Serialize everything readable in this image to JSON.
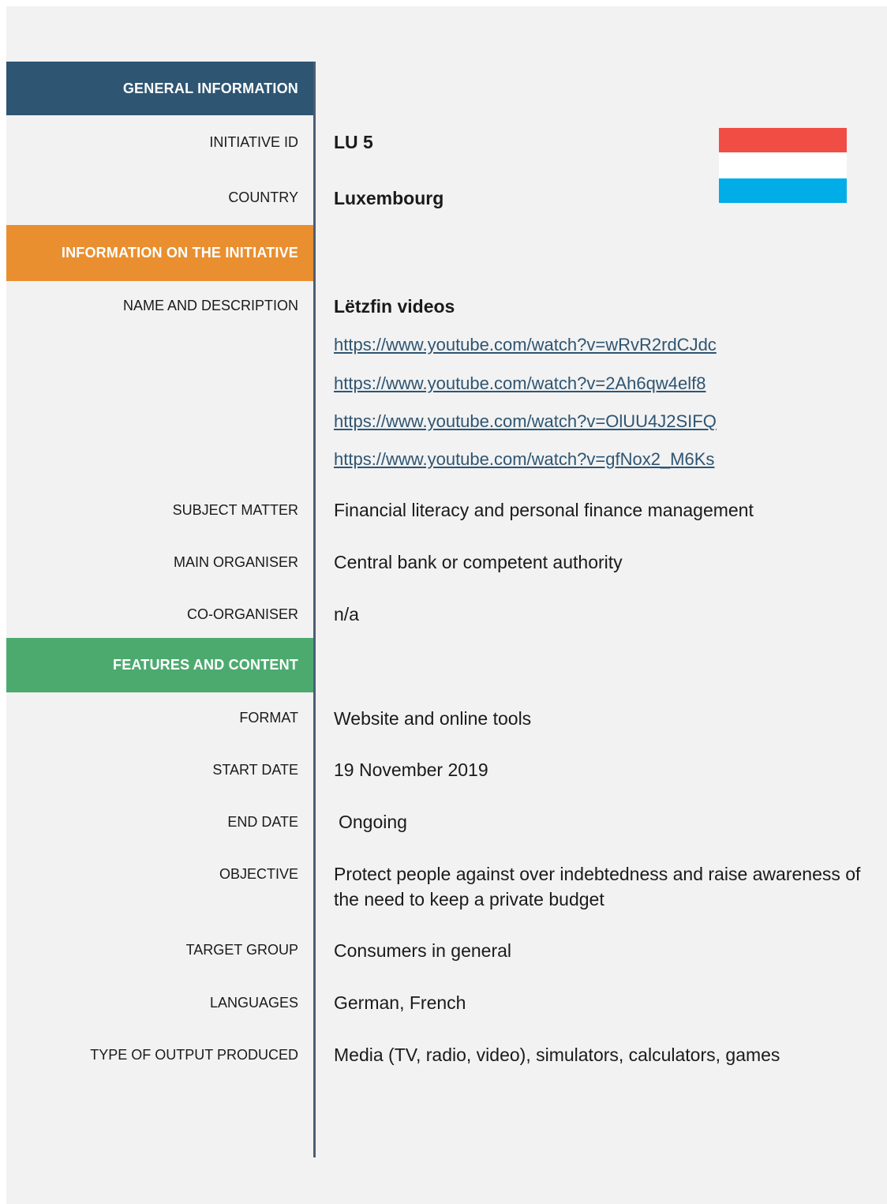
{
  "sections": {
    "general": "GENERAL  INFORMATION",
    "info": "INFORMATION  ON  THE  INITIATIVE",
    "features": "FEATURES  AND  CONTENT"
  },
  "fields": {
    "initiative_id": {
      "label": "INITIATIVE  ID",
      "value": "LU 5"
    },
    "country": {
      "label": "COUNTRY",
      "value": "Luxembourg"
    },
    "name_description": {
      "label": "NAME  AND  DESCRIPTION",
      "value": "Lëtzfin videos",
      "links": [
        "https://www.youtube.com/watch?v=wRvR2rdCJdc",
        "https://www.youtube.com/watch?v=2Ah6qw4elf8",
        "https://www.youtube.com/watch?v=OlUU4J2SIFQ",
        "https://www.youtube.com/watch?v=gfNox2_M6Ks"
      ]
    },
    "subject_matter": {
      "label": "SUBJECT  MATTER",
      "value": "Financial literacy and personal finance management"
    },
    "main_organiser": {
      "label": "MAIN  ORGANISER",
      "value": "Central bank or competent authority"
    },
    "co_organiser": {
      "label": "CO-ORGANISER",
      "value": "n/a"
    },
    "format": {
      "label": "FORMAT",
      "value": "Website and online tools"
    },
    "start_date": {
      "label": "START  DATE",
      "value": "19 November 2019"
    },
    "end_date": {
      "label": "END  DATE",
      "value": "Ongoing"
    },
    "objective": {
      "label": "OBJECTIVE",
      "value": "Protect people against over indebtedness and raise awareness of the need to keep a private budget"
    },
    "target_group": {
      "label": "TARGET  GROUP",
      "value": "Consumers in general"
    },
    "languages": {
      "label": "LANGUAGES",
      "value": "German, French"
    },
    "output_type": {
      "label": "TYPE  OF  OUTPUT  PRODUCED",
      "value": "Media (TV, radio, video), simulators, calculators, games"
    }
  },
  "flag": {
    "name": "luxembourg-flag",
    "colors": [
      "#f04e45",
      "#ffffff",
      "#00ade6"
    ]
  }
}
